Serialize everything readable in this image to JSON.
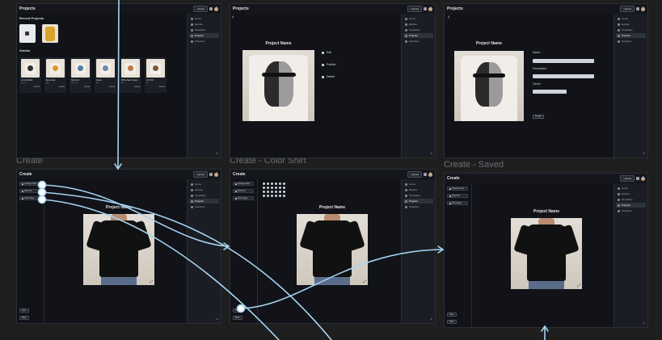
{
  "labels": {
    "create": "Create",
    "create_color": "Create - Color Shirt",
    "create_saved": "Create - Saved"
  },
  "projects": {
    "title": "Projects",
    "upload": "Upload",
    "recent": "Recent Projects",
    "similar": "Similar",
    "similar_items": [
      {
        "title": "Andy Warhol",
        "sub": "Classic",
        "price": "$24.99",
        "color": "#2f2f2f"
      },
      {
        "title": "Bored Ape",
        "sub": "Ape",
        "price": "$24.99",
        "color": "#d79a2a"
      },
      {
        "title": "Spiral Art",
        "sub": "Abstract",
        "price": "$24.99",
        "color": "#4f7ea8"
      },
      {
        "title": "Figure",
        "sub": "Art",
        "price": "$24.99",
        "color": "#6a89b0"
      },
      {
        "title": "White Man Design",
        "sub": "Art",
        "price": "$24.99",
        "color": "#c07a4a"
      },
      {
        "title": "Art Shirt",
        "sub": "Art",
        "price": "$24.99",
        "color": "#7a5a3a"
      }
    ]
  },
  "sidebar": {
    "items": [
      "Home",
      "Explore",
      "Templates",
      "Projects",
      "Favorites"
    ],
    "active": "Projects",
    "bottom": "⚙"
  },
  "project_detail": {
    "name": "Project Name",
    "actions": [
      "Edit",
      "Publish",
      "Delete"
    ]
  },
  "project_edit": {
    "name": "Project Name",
    "fields": [
      "Name",
      "Description",
      "Genre"
    ],
    "button": "Publish"
  },
  "create": {
    "title": "Create",
    "options": [
      "Change Color",
      "Add Text",
      "Add Image"
    ],
    "project_name": "Project Name",
    "buttons": [
      "Save",
      "Back"
    ]
  },
  "colors": {
    "arrow": "#a6d4f2",
    "bg": "#1e1e1e",
    "panel": "#111318"
  }
}
